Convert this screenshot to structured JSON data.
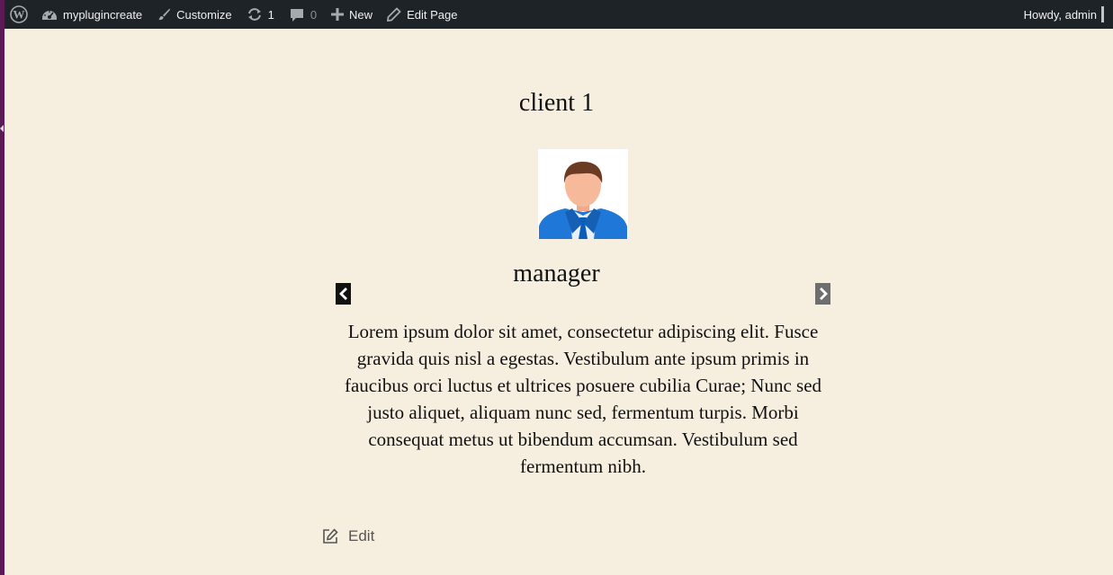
{
  "adminbar": {
    "site_name": "myplugincreate",
    "customize_label": "Customize",
    "updates_count": "1",
    "comments_count": "0",
    "new_label": "New",
    "edit_page_label": "Edit Page",
    "greeting": "Howdy, admin"
  },
  "testimonial": {
    "title": "client 1",
    "photo_icon": "businessman-avatar",
    "role": "manager",
    "text": "Lorem ipsum dolor sit amet, consectetur adipiscing elit. Fusce gravida quis nisl a egestas. Vestibulum ante ipsum primis in faucibus orci luctus et ultrices posuere cubilia Curae; Nunc sed justo aliquet, aliquam nunc sed, fermentum turpis. Morbi consequat metus ut bibendum accumsan. Vestibulum sed fermentum nibh."
  },
  "edit_link": {
    "label": "Edit"
  },
  "colors": {
    "page_background": "#f6efe0",
    "adminbar_background": "#1d2327",
    "left_stripe": "#5b1a55"
  }
}
